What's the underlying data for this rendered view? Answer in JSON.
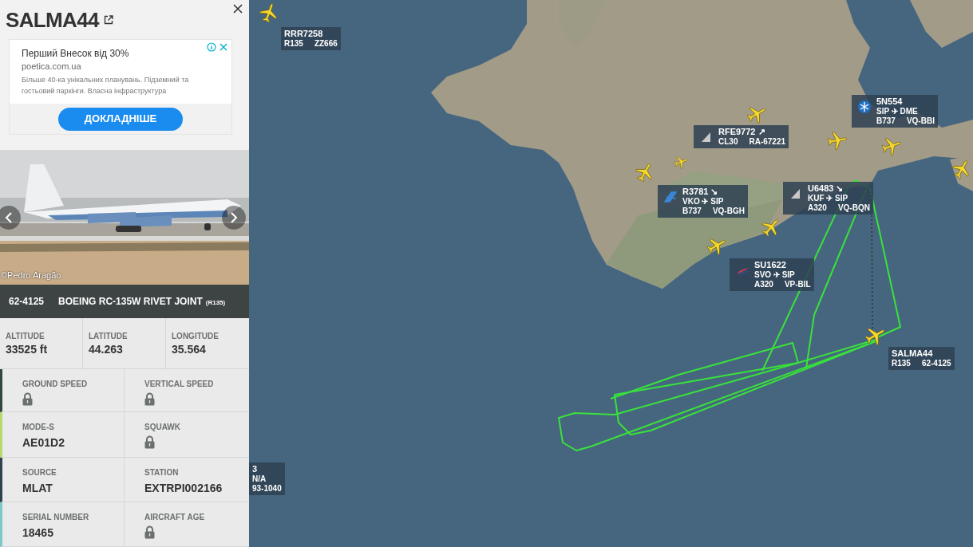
{
  "panel": {
    "callsign": "SALMA44",
    "ad": {
      "headline": "Перший Внесок від 30%",
      "domain": "poetica.com.ua",
      "text": "Більше 40-ка унікальних планувань. Підземний та гостьовий паркінги. Власна інфраструктура",
      "button": "ДОКЛАДНІШЕ"
    },
    "photo": {
      "kind": "picture",
      "credit": "©Pedro Aragão"
    },
    "registration": "62-4125",
    "aircraft": "BOEING RC-135W RIVET JOINT",
    "type_code": "(R135)",
    "position": [
      {
        "label": "ALTITUDE",
        "value": "33525 ft"
      },
      {
        "label": "LATITUDE",
        "value": "44.263"
      },
      {
        "label": "LONGITUDE",
        "value": "35.564"
      }
    ],
    "details": [
      {
        "label": "GROUND SPEED",
        "locked": true
      },
      {
        "label": "VERTICAL SPEED",
        "locked": true
      },
      {
        "label": "MODE-S",
        "value": "AE01D2",
        "locked": false
      },
      {
        "label": "SQUAWK",
        "locked": true
      },
      {
        "label": "SOURCE",
        "value": "MLAT",
        "locked": false
      },
      {
        "label": "STATION",
        "value": "EXTRPI002166",
        "locked": false
      },
      {
        "label": "SERIAL NUMBER",
        "value": "18465",
        "locked": false
      },
      {
        "label": "AIRCRAFT AGE",
        "locked": true
      }
    ]
  },
  "map": {
    "flights": [
      {
        "lines": [
          [
            "RRR7258"
          ],
          [
            "R135",
            "ZZ666"
          ]
        ]
      },
      {
        "lines": [
          [
            "RFE9772 ↗"
          ],
          [
            "CL30",
            "RA-67221"
          ]
        ]
      },
      {
        "lines": [
          [
            "5N554"
          ],
          [
            "SIP ✈ DME"
          ],
          [
            "B737",
            "VQ-BBI"
          ]
        ]
      },
      {
        "lines": [
          [
            "R3781 ↘"
          ],
          [
            "VKO ✈ SIP"
          ],
          [
            "B737",
            "VQ-BGH"
          ]
        ]
      },
      {
        "lines": [
          [
            "U6483 ↘"
          ],
          [
            "KUF ✈ SIP"
          ],
          [
            "A320",
            "VQ-BQN"
          ]
        ]
      },
      {
        "lines": [
          [
            "SU1622"
          ],
          [
            "SVO ✈ SIP"
          ],
          [
            "A320",
            "VP-BIL"
          ]
        ]
      },
      {
        "lines": [
          [
            "SALMA44"
          ],
          [
            "R135",
            "62-4125"
          ]
        ]
      },
      {
        "lines": [
          [
            "3"
          ],
          [
            "N/A"
          ],
          [
            "93-1040"
          ]
        ]
      }
    ]
  }
}
